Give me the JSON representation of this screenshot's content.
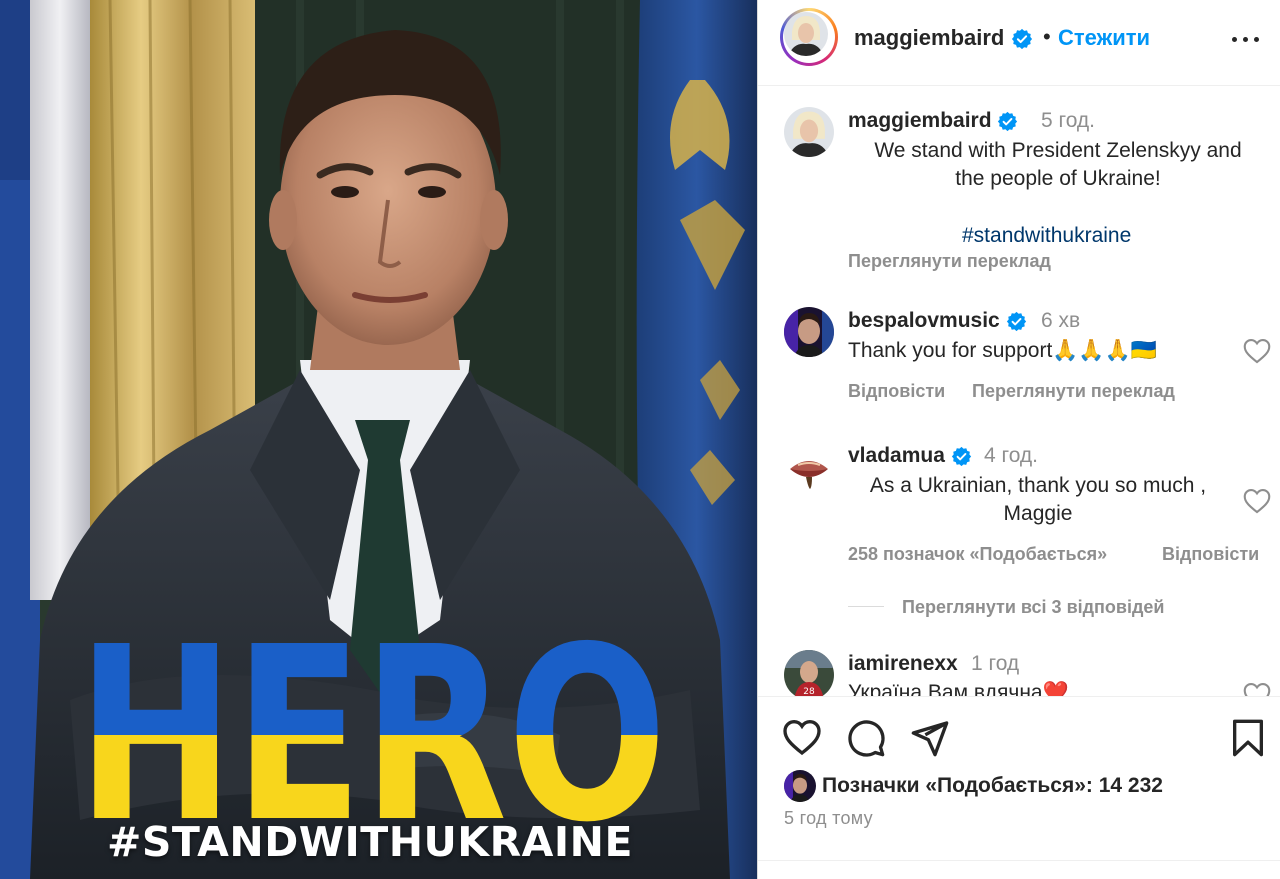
{
  "post": {
    "overlay_word": "HERO",
    "overlay_hashtag": "#STANDWITHUKRAINE",
    "colors": {
      "flag_blue": "#1a5fc8",
      "flag_yellow": "#f8d61c",
      "link_blue": "#0095f6",
      "hashtag_blue": "#00376b"
    }
  },
  "header": {
    "username": "maggiembaird",
    "separator": "•",
    "follow_label": "Стежити",
    "more_icon": "more-horizontal-icon"
  },
  "caption": {
    "username": "maggiembaird",
    "time": "5 год.",
    "text_line1": "We stand with President Zelenskyy and",
    "text_line2": "the people of Ukraine!",
    "hashtag": "#standwithukraine",
    "translate_label": "Переглянути переклад"
  },
  "comments": [
    {
      "username": "bespalovmusic",
      "time": "6 хв",
      "text": "Thank you for support🙏🙏🙏🇺🇦",
      "reply_label": "Відповісти",
      "translate_label": "Переглянути переклад"
    },
    {
      "username": "vladamua",
      "time": "4 год.",
      "text_line1": "As a Ukrainian, thank you so much ,",
      "text_line2": "Maggie",
      "likes_label": "258 позначок «Подобається»",
      "reply_label": "Відповісти",
      "view_replies_label": "Переглянути всі 3 відповідей"
    },
    {
      "username": "iamirenexx",
      "time": "1 год",
      "text": "Україна Вам вдячна❤️"
    }
  ],
  "actions": {
    "like_icon": "heart-icon",
    "comment_icon": "comment-icon",
    "share_icon": "send-icon",
    "save_icon": "bookmark-icon"
  },
  "likes": {
    "text": "Позначки «Подобається»: 14 232"
  },
  "posted_ago": "5 год тому"
}
